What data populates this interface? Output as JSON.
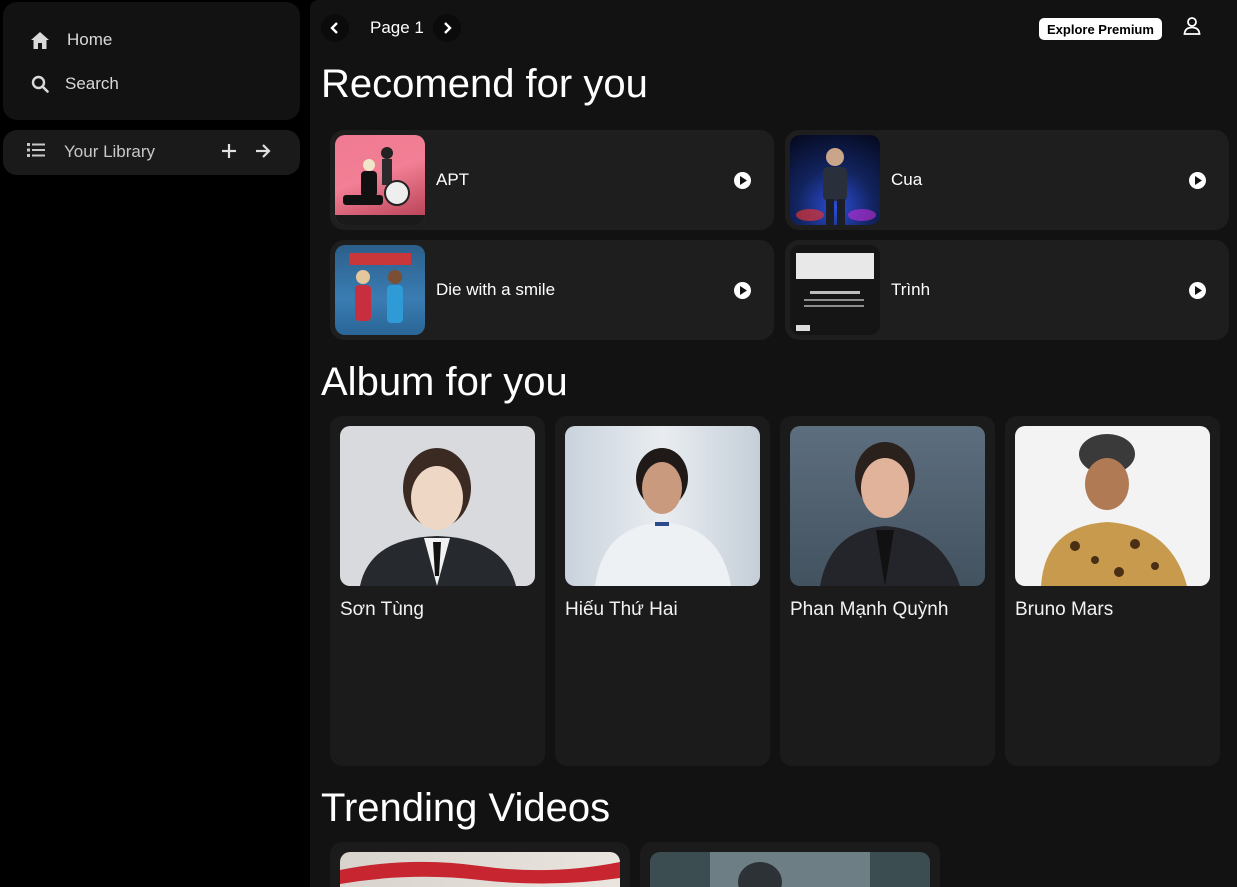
{
  "sidebar": {
    "home_label": "Home",
    "search_label": "Search",
    "library_label": "Your Library"
  },
  "topbar": {
    "page_label": "Page 1",
    "premium_label": "Explore Premium"
  },
  "recommend": {
    "title": "Recomend for you",
    "items": [
      {
        "title": "APT"
      },
      {
        "title": "Cua"
      },
      {
        "title": "Die with a smile"
      },
      {
        "title": "Trình"
      }
    ]
  },
  "albums": {
    "title": "Album for you",
    "items": [
      {
        "artist": "Sơn Tùng"
      },
      {
        "artist": "Hiếu Thứ Hai"
      },
      {
        "artist": "Phan Mạnh Quỳnh"
      },
      {
        "artist": "Bruno Mars"
      }
    ]
  },
  "trending": {
    "title": "Trending Videos"
  },
  "colors": {
    "background": "#000000",
    "panel": "#121212",
    "card": "#1e1e1e",
    "text": "#ffffff",
    "premium_bg": "#ffffff"
  }
}
